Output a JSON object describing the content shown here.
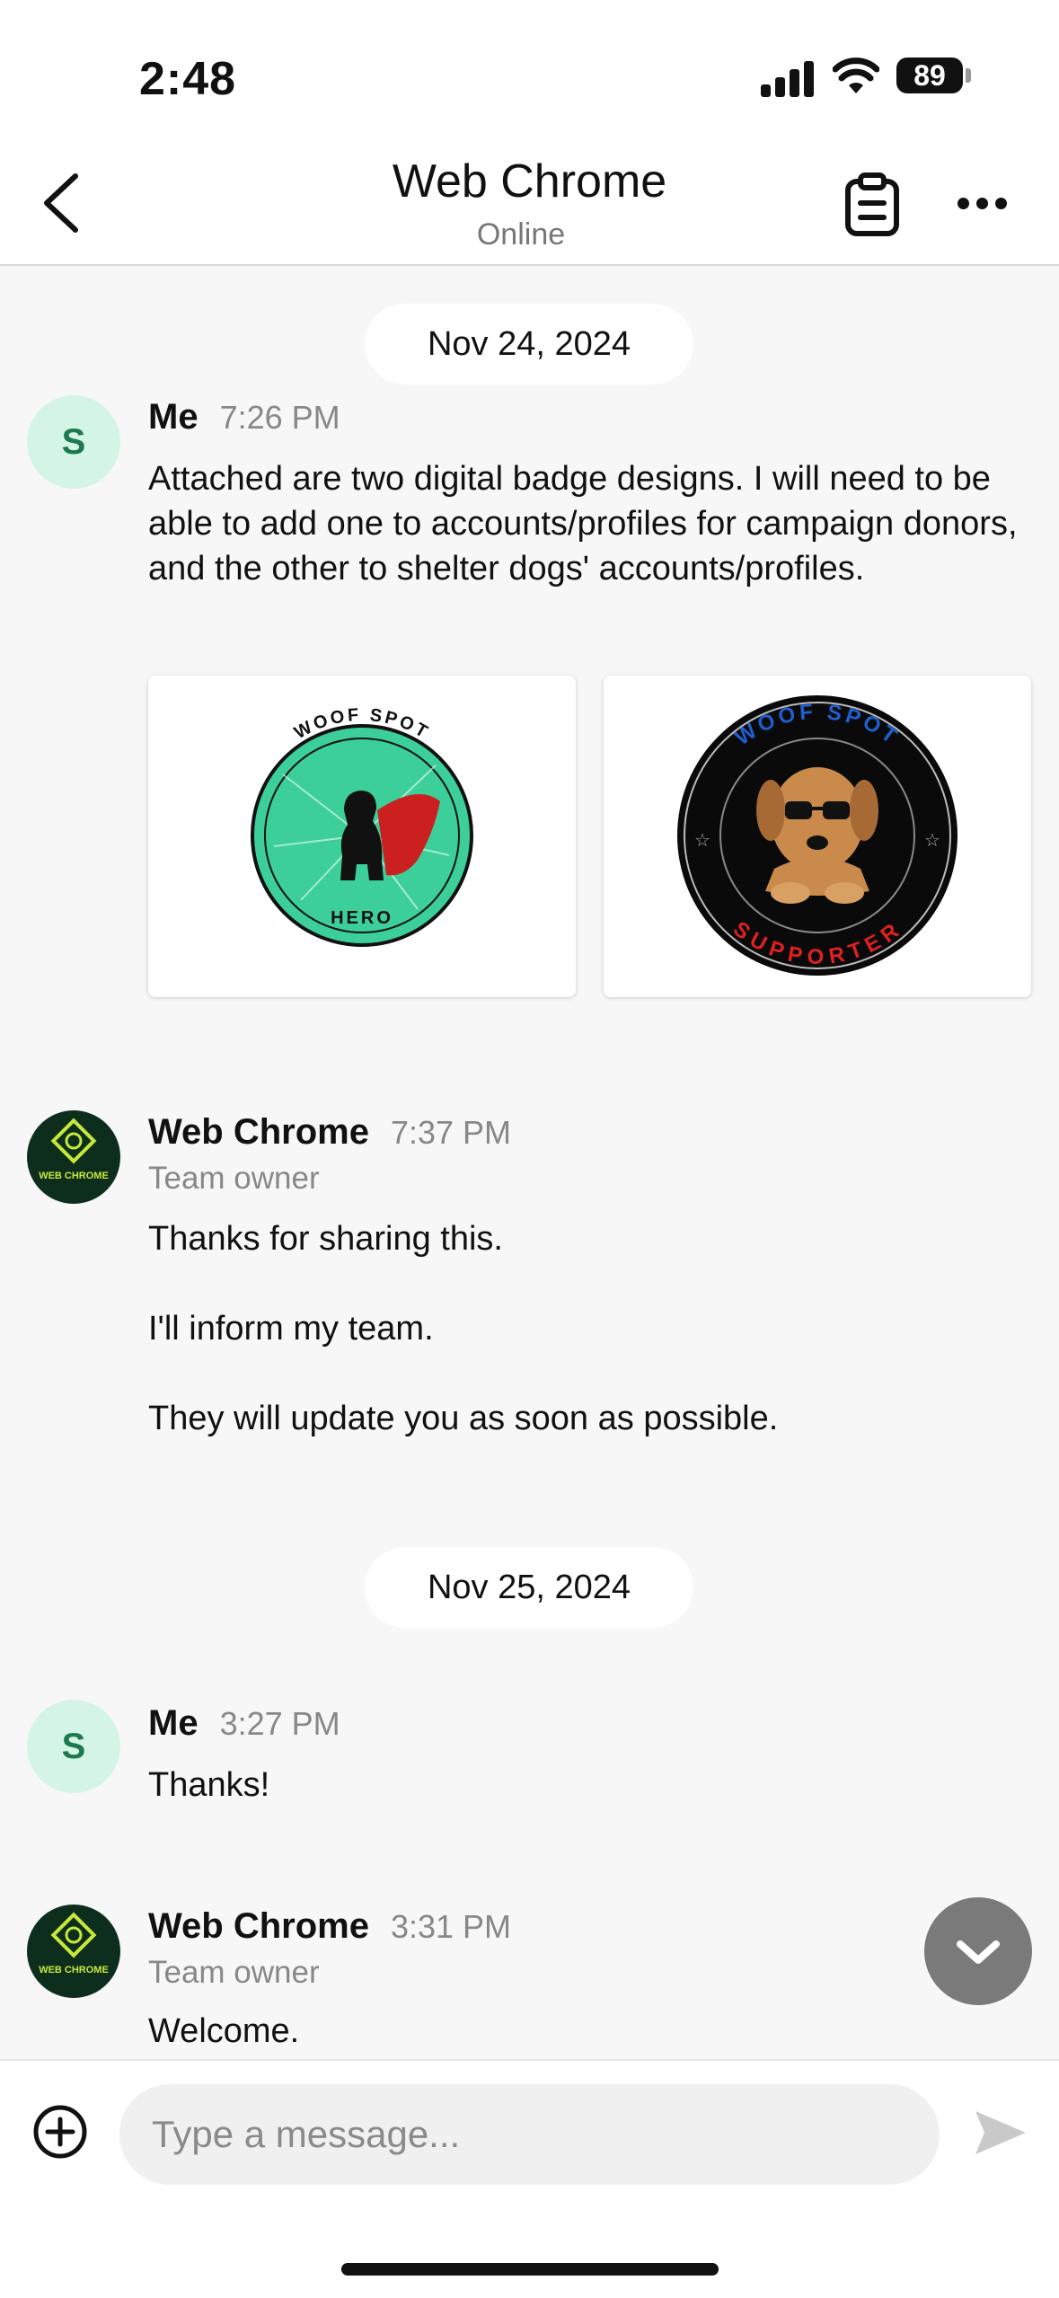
{
  "status_bar": {
    "time": "2:48",
    "battery": "89"
  },
  "header": {
    "title": "Web Chrome",
    "subtitle": "Online"
  },
  "messages": [
    {
      "date": "Nov 24, 2024"
    },
    {
      "avatar_letter": "S",
      "sender": "Me",
      "time": "7:26 PM",
      "text": "Attached are two digital badge designs.  I will need to be able to add one to accounts/profiles for campaign donors, and the other to shelter dogs' accounts/profiles.",
      "attachments": [
        {
          "top_text": "WOOF SPOT",
          "bottom_text": "HERO"
        },
        {
          "top_text": "WOOF SPOT",
          "bottom_text": "SUPPORTER"
        }
      ]
    },
    {
      "avatar_text": "WEB CHROME",
      "sender": "Web Chrome",
      "time": "7:37 PM",
      "role": "Team owner",
      "lines": [
        "Thanks for sharing this.",
        "I'll inform my team.",
        "They will update you as soon as possible."
      ]
    },
    {
      "date": "Nov 25, 2024"
    },
    {
      "avatar_letter": "S",
      "sender": "Me",
      "time": "3:27 PM",
      "text": "Thanks!"
    },
    {
      "avatar_text": "WEB CHROME",
      "sender": "Web Chrome",
      "time": "3:31 PM",
      "role": "Team owner",
      "text": "Welcome."
    }
  ],
  "composer": {
    "placeholder": "Type a message..."
  },
  "colors": {
    "avatar_me_bg": "#d4f5e6",
    "avatar_wc_bg": "#0d2e1d",
    "badge_hero_bg": "#3ccf9a",
    "badge_supporter_text": "#e02020"
  }
}
